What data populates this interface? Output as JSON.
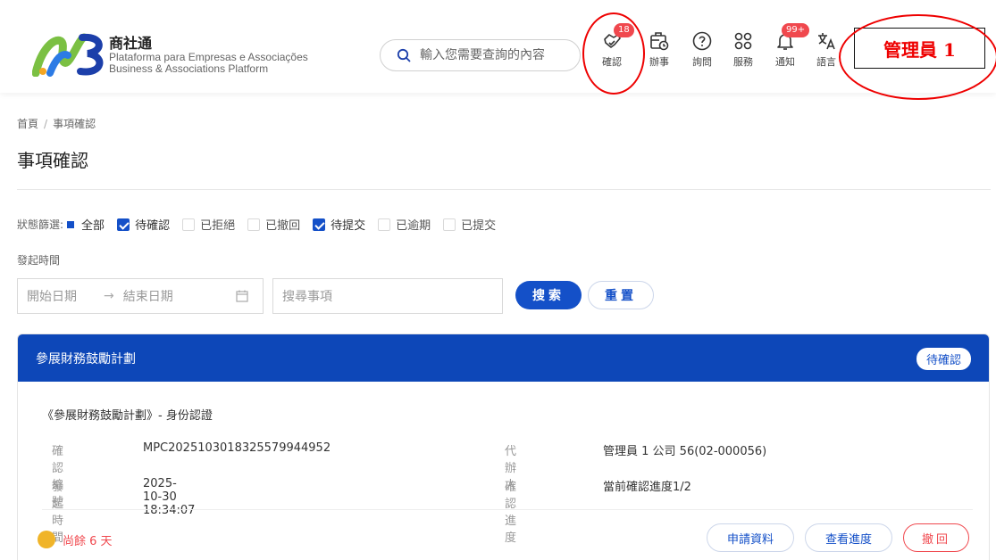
{
  "header": {
    "brand_cn": "商社通",
    "brand_pt": "Plataforma para Empresas e Associações",
    "brand_en": "Business & Associations Platform",
    "search_placeholder": "輸入您需要查詢的內容",
    "nav": [
      {
        "label": "確認",
        "icon": "handshake-check-icon",
        "badge": "18"
      },
      {
        "label": "辦事",
        "icon": "briefcase-clock-icon",
        "badge": ""
      },
      {
        "label": "詢問",
        "icon": "question-circle-icon",
        "badge": ""
      },
      {
        "label": "服務",
        "icon": "grid-services-icon",
        "badge": ""
      },
      {
        "label": "通知",
        "icon": "bell-icon",
        "badge": "99+"
      },
      {
        "label": "語言",
        "icon": "translate-icon",
        "badge": ""
      }
    ],
    "admin_label": "管理員 1",
    "annotation_color": "#e00000"
  },
  "breadcrumb": {
    "home": "首頁",
    "current": "事項確認"
  },
  "page_title": "事項確認",
  "filter": {
    "label": "狀態篩選:",
    "options": [
      {
        "label": "全部",
        "state": "indeterminate"
      },
      {
        "label": "待確認",
        "state": "checked"
      },
      {
        "label": "已拒絕",
        "state": "unchecked"
      },
      {
        "label": "已撤回",
        "state": "unchecked"
      },
      {
        "label": "待提交",
        "state": "checked"
      },
      {
        "label": "已逾期",
        "state": "unchecked"
      },
      {
        "label": "已提交",
        "state": "unchecked"
      }
    ]
  },
  "date": {
    "label": "發起時間",
    "start_placeholder": "開始日期",
    "end_placeholder": "結束日期"
  },
  "keyword_placeholder": "搜尋事項",
  "buttons": {
    "search": "搜索",
    "reset": "重置"
  },
  "card": {
    "title": "參展財務鼓勵計劃",
    "status": "待確認",
    "subtitle": "《參展財務鼓勵計劃》- 身份認證",
    "fields": {
      "id_key": "確認編號",
      "id_val": "MPC202510301832557994495 2",
      "agent_key": "代辦人",
      "agent_val": "管理員 1 公司 56(02-000056)",
      "time_key": "發起時間",
      "time_val": "2025-10-30 18:34:07",
      "progress_key": "確認進度",
      "progress_val": "當前確認進度1/2"
    },
    "remaining": "尚餘 6 天",
    "actions": {
      "apply": "申請資料",
      "progress": "查看進度",
      "withdraw": "撤回"
    },
    "colors": {
      "header": "#0d47b8",
      "accent": "#1450c8",
      "danger": "#f0484e",
      "warning": "#f0b429"
    }
  }
}
